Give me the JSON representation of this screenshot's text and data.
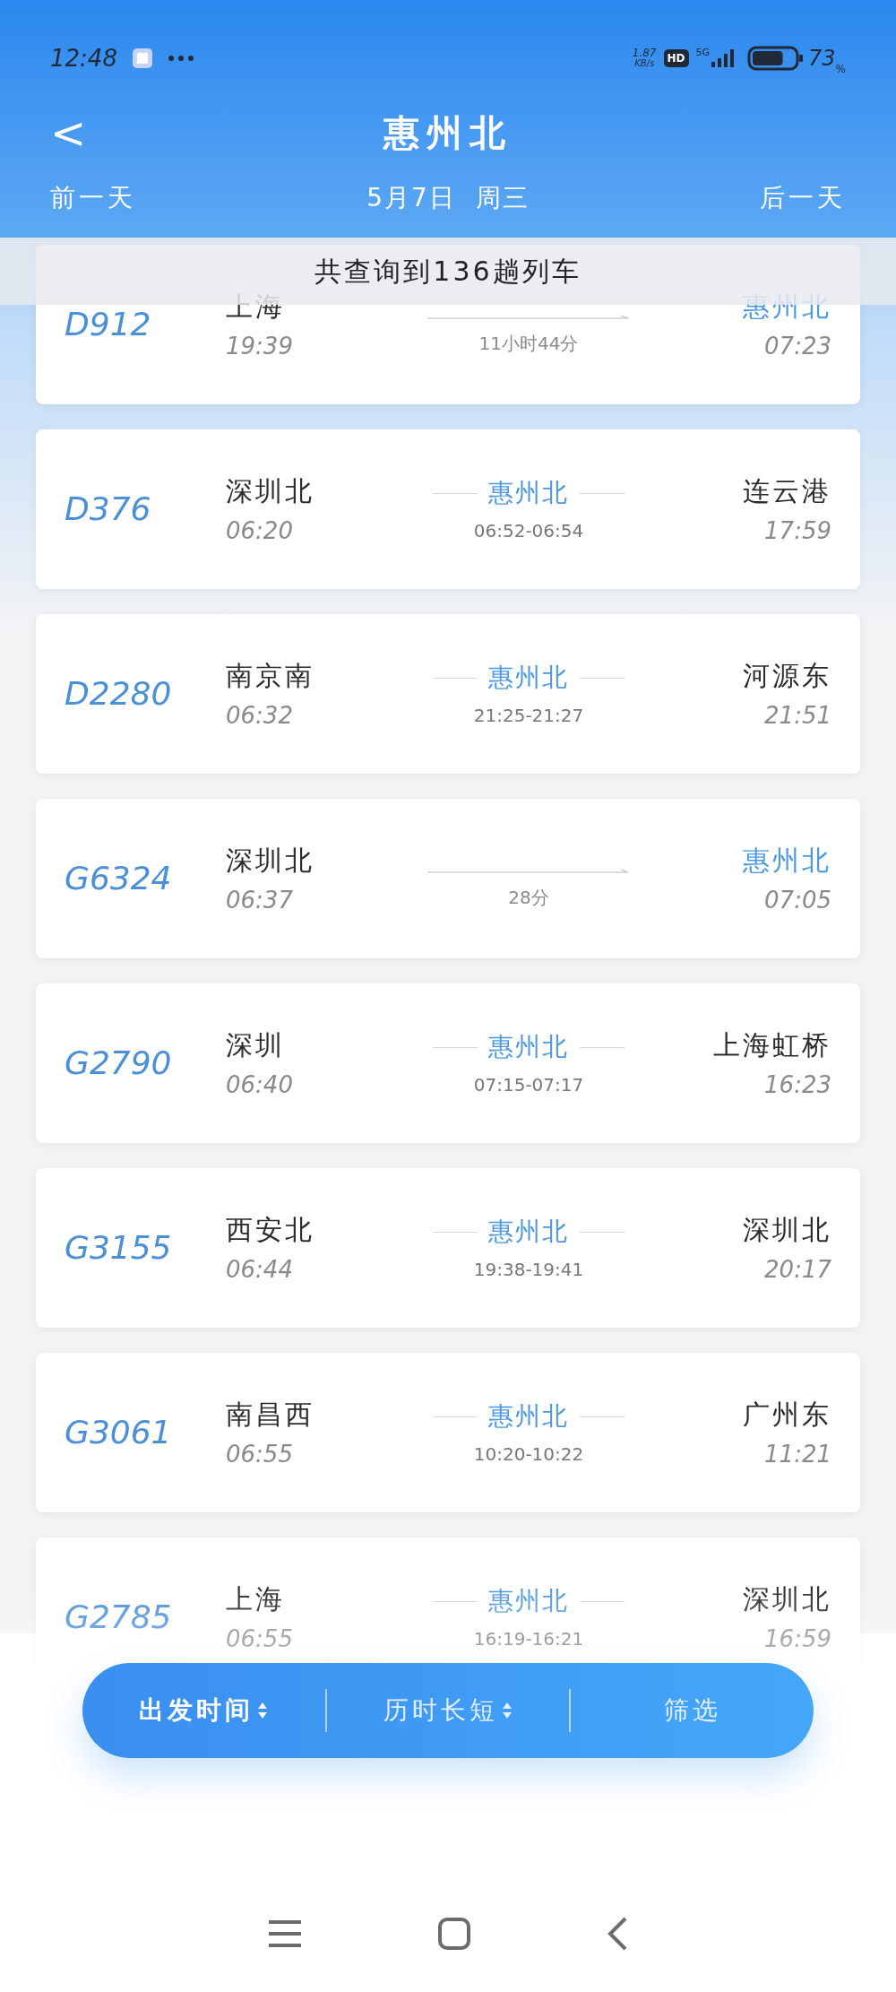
{
  "status_bar": {
    "time": "12:48",
    "speed": "1.87",
    "speed_unit": "KB/s",
    "hd": "HD",
    "network": "5G",
    "battery_text": "73",
    "battery_unit": "%",
    "battery": {
      "level": 0.73
    }
  },
  "header": {
    "back": "<",
    "title": "惠州北",
    "prev_day": "前一天",
    "date": "5月7日  周三",
    "next_day": "后一天"
  },
  "result_banner": "共查询到136趟列车",
  "trains": [
    {
      "number": "D912",
      "kind": "direct",
      "from": {
        "name": "上海",
        "time": "19:39",
        "highlight": false
      },
      "to": {
        "name": "惠州北",
        "time": "07:23",
        "highlight": true
      },
      "duration": "11小时44分"
    },
    {
      "number": "D376",
      "kind": "via",
      "from": {
        "name": "深圳北",
        "time": "06:20",
        "highlight": false
      },
      "to": {
        "name": "连云港",
        "time": "17:59",
        "highlight": false
      },
      "via": {
        "name": "惠州北",
        "times": "06:52-06:54"
      }
    },
    {
      "number": "D2280",
      "kind": "via",
      "from": {
        "name": "南京南",
        "time": "06:32",
        "highlight": false
      },
      "to": {
        "name": "河源东",
        "time": "21:51",
        "highlight": false
      },
      "via": {
        "name": "惠州北",
        "times": "21:25-21:27"
      }
    },
    {
      "number": "G6324",
      "kind": "direct",
      "from": {
        "name": "深圳北",
        "time": "06:37",
        "highlight": false
      },
      "to": {
        "name": "惠州北",
        "time": "07:05",
        "highlight": true
      },
      "duration": "28分"
    },
    {
      "number": "G2790",
      "kind": "via",
      "from": {
        "name": "深圳",
        "time": "06:40",
        "highlight": false
      },
      "to": {
        "name": "上海虹桥",
        "time": "16:23",
        "highlight": false
      },
      "via": {
        "name": "惠州北",
        "times": "07:15-07:17"
      }
    },
    {
      "number": "G3155",
      "kind": "via",
      "from": {
        "name": "西安北",
        "time": "06:44",
        "highlight": false
      },
      "to": {
        "name": "深圳北",
        "time": "20:17",
        "highlight": false
      },
      "via": {
        "name": "惠州北",
        "times": "19:38-19:41"
      }
    },
    {
      "number": "G3061",
      "kind": "via",
      "from": {
        "name": "南昌西",
        "time": "06:55",
        "highlight": false
      },
      "to": {
        "name": "广州东",
        "time": "11:21",
        "highlight": false
      },
      "via": {
        "name": "惠州北",
        "times": "10:20-10:22"
      }
    },
    {
      "number": "G2785",
      "kind": "via",
      "from": {
        "name": "上海",
        "time": "06:55",
        "highlight": false
      },
      "to": {
        "name": "深圳北",
        "time": "16:59",
        "highlight": false
      },
      "via": {
        "name": "惠州北",
        "times": "16:19-16:21"
      }
    }
  ],
  "sort_bar": [
    {
      "label": "出发时间",
      "sortable": true,
      "selected": true
    },
    {
      "label": "历时长短",
      "sortable": true,
      "selected": false
    },
    {
      "label": "筛选",
      "sortable": false,
      "selected": false
    }
  ]
}
